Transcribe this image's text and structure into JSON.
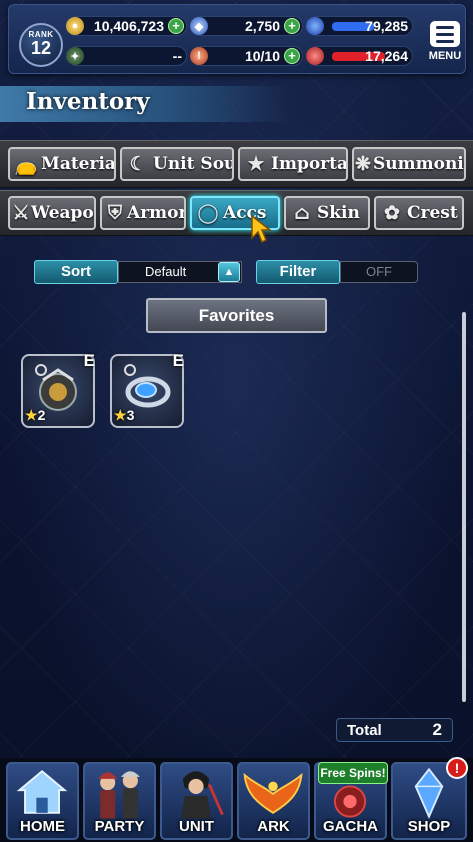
{
  "topbar": {
    "rank_label": "RANK",
    "rank_value": "12",
    "gil": "10,406,723",
    "crystals": "2,750",
    "exp_value": "79,285",
    "guild_value": "--",
    "stamina": "10/10",
    "hp_value": "17,264",
    "menu_label": "MENU",
    "exp_fill": 0.55,
    "hp_fill": 0.7
  },
  "header": {
    "title": "Inventory"
  },
  "categories": {
    "row1": [
      {
        "label": "Material",
        "icon": "material-bag-icon"
      },
      {
        "label": "Unit Soul",
        "icon": "unit-soul-icon"
      },
      {
        "label": "Important",
        "icon": "star-icon"
      },
      {
        "label": "Summoning",
        "icon": "summoning-icon"
      }
    ],
    "row2": [
      {
        "label": "Weapon",
        "icon": "sword-icon"
      },
      {
        "label": "Armor",
        "icon": "armor-icon"
      },
      {
        "label": "Accs",
        "icon": "ring-icon",
        "active": true
      },
      {
        "label": "Skin",
        "icon": "hanger-icon"
      },
      {
        "label": "Crest",
        "icon": "crest-icon"
      }
    ]
  },
  "controls": {
    "sort_label": "Sort",
    "sort_value": "Default",
    "filter_label": "Filter",
    "filter_value": "OFF",
    "favorites_label": "Favorites"
  },
  "items": [
    {
      "stars": "2",
      "equipped_mark": "E",
      "icon": "dark-accessory-icon"
    },
    {
      "stars": "3",
      "equipped_mark": "E",
      "icon": "blue-ring-accessory-icon"
    }
  ],
  "total": {
    "label": "Total",
    "value": "2"
  },
  "nav": {
    "home": "HOME",
    "party": "PARTY",
    "unit": "UNIT",
    "ark": "ARK",
    "gacha": "GACHA",
    "shop": "SHOP",
    "free_spins": "Free Spins!",
    "shop_badge": "!"
  },
  "colors": {
    "accent": "#2c8fa6",
    "exp_bar": "#2f6cf0",
    "hp_bar": "#e0202a",
    "plus": "#3aa546"
  }
}
